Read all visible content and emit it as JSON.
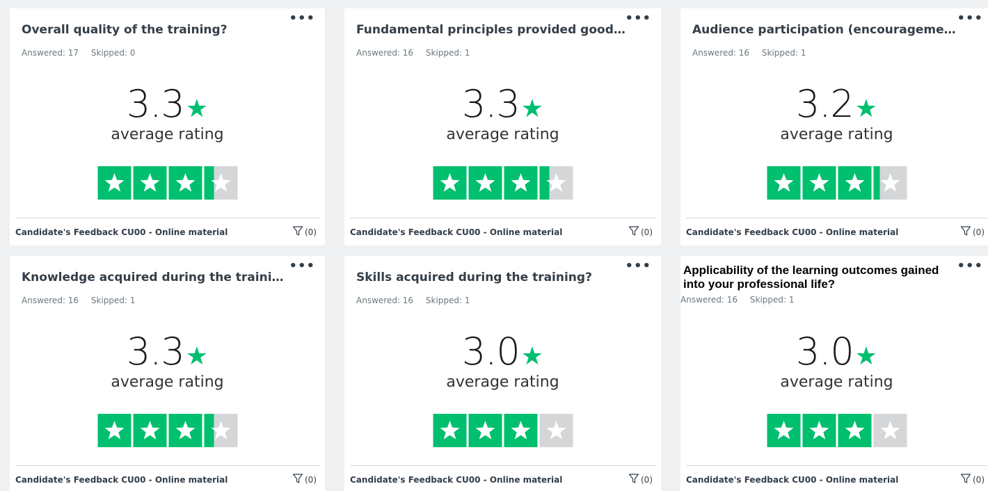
{
  "cards": [
    {
      "title": "Overall quality of the training?",
      "answered": "Answered: 17",
      "skipped": "Skipped: 0",
      "score": "3.3",
      "rating_label": "average rating",
      "rating_value": 3.3,
      "footer": "Candidate's Feedback CU00 - Online material",
      "filter": "(0)"
    },
    {
      "title": "Fundamental principles provided good un...",
      "answered": "Answered: 16",
      "skipped": "Skipped: 1",
      "score": "3.3",
      "rating_label": "average rating",
      "rating_value": 3.3,
      "footer": "Candidate's Feedback CU00 - Online material",
      "filter": "(0)"
    },
    {
      "title": "Audience participation (encouragement)?",
      "answered": "Answered: 16",
      "skipped": "Skipped: 1",
      "score": "3.2",
      "rating_label": "average rating",
      "rating_value": 3.2,
      "footer": "Candidate's Feedback CU00 - Online material",
      "filter": "(0)"
    },
    {
      "title": "Knowledge acquired during the training?",
      "answered": "Answered: 16",
      "skipped": "Skipped: 1",
      "score": "3.3",
      "rating_label": "average rating",
      "rating_value": 3.3,
      "footer": "Candidate's Feedback CU00 - Online material",
      "filter": "(0)"
    },
    {
      "title": "Skills acquired during the training?",
      "answered": "Answered: 16",
      "skipped": "Skipped: 1",
      "score": "3.0",
      "rating_label": "average rating",
      "rating_value": 3.0,
      "footer": "Candidate's Feedback CU00 - Online material",
      "filter": "(0)"
    },
    {
      "title": "Applicability of the learning outcomes gained into your professional life?",
      "answered": "Answered: 16",
      "skipped": "Skipped: 1",
      "score": "3.0",
      "rating_label": "average rating",
      "rating_value": 3.0,
      "footer": "Candidate's Feedback CU00 - Online material",
      "filter": "(0)"
    }
  ],
  "colors": {
    "star_fill": "#00bf6f",
    "star_empty": "#d4d6d8"
  },
  "icons": {
    "more": "more-options-icon",
    "filter": "filter-icon",
    "star": "star-icon"
  }
}
